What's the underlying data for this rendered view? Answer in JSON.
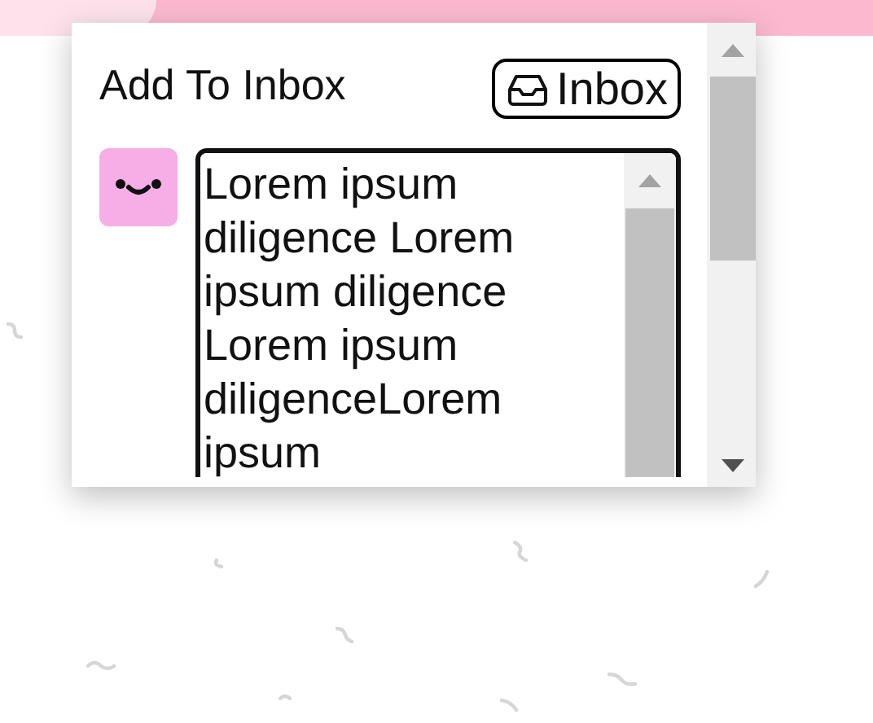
{
  "popup": {
    "title": "Add To Inbox",
    "inbox_button": {
      "label": "Inbox"
    },
    "message": {
      "value": "Lorem ipsum diligence Lorem ipsum diligence Lorem ipsum diligenceLorem ipsum"
    }
  }
}
